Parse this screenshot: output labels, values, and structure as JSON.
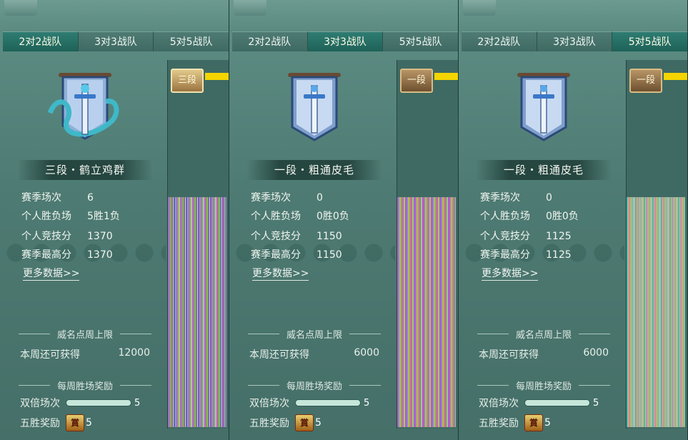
{
  "panels": [
    {
      "tabs": [
        "2对2战队",
        "3对3战队",
        "5对5战队"
      ],
      "active_tab": 0,
      "rank_badge": "三段",
      "rank_title": "三段・鹤立鸡群",
      "stats": [
        {
          "label": "赛季场次",
          "value": "6"
        },
        {
          "label": "个人胜负场",
          "value": "5胜1负"
        },
        {
          "label": "个人竞技分",
          "value": "1370"
        },
        {
          "label": "赛季最高分",
          "value": "1370"
        }
      ],
      "more_data": "更多数据>>",
      "fame_title": "威名点周上限",
      "weekly_label": "本周还可获得",
      "weekly_value": "12000",
      "reward_title": "每周胜场奖励",
      "double_label": "双倍场次",
      "double_count": "5",
      "double_progress": 1.0,
      "five_label": "五胜奖励",
      "five_count": "5"
    },
    {
      "tabs": [
        "2对2战队",
        "3对3战队",
        "5对5战队"
      ],
      "active_tab": 1,
      "rank_badge": "一段",
      "rank_title": "一段・粗通皮毛",
      "stats": [
        {
          "label": "赛季场次",
          "value": "0"
        },
        {
          "label": "个人胜负场",
          "value": "0胜0负"
        },
        {
          "label": "个人竞技分",
          "value": "1150"
        },
        {
          "label": "赛季最高分",
          "value": "1150"
        }
      ],
      "more_data": "更多数据>>",
      "fame_title": "威名点周上限",
      "weekly_label": "本周还可获得",
      "weekly_value": "6000",
      "reward_title": "每周胜场奖励",
      "double_label": "双倍场次",
      "double_count": "5",
      "double_progress": 1.0,
      "five_label": "五胜奖励",
      "five_count": "5"
    },
    {
      "tabs": [
        "2对2战队",
        "3对3战队",
        "5对5战队"
      ],
      "active_tab": 2,
      "rank_badge": "一段",
      "rank_title": "一段・粗通皮毛",
      "stats": [
        {
          "label": "赛季场次",
          "value": "0"
        },
        {
          "label": "个人胜负场",
          "value": "0胜0负"
        },
        {
          "label": "个人竞技分",
          "value": "1125"
        },
        {
          "label": "赛季最高分",
          "value": "1125"
        }
      ],
      "more_data": "更多数据>>",
      "fame_title": "威名点周上限",
      "weekly_label": "本周还可获得",
      "weekly_value": "6000",
      "reward_title": "每周胜场奖励",
      "double_label": "双倍场次",
      "double_count": "5",
      "double_progress": 1.0,
      "five_label": "五胜奖励",
      "five_count": "5"
    }
  ],
  "colors": {
    "panel_bg": "#5a8a80",
    "active_tab": "#1e6258",
    "rank_bar": "#f4d500"
  }
}
